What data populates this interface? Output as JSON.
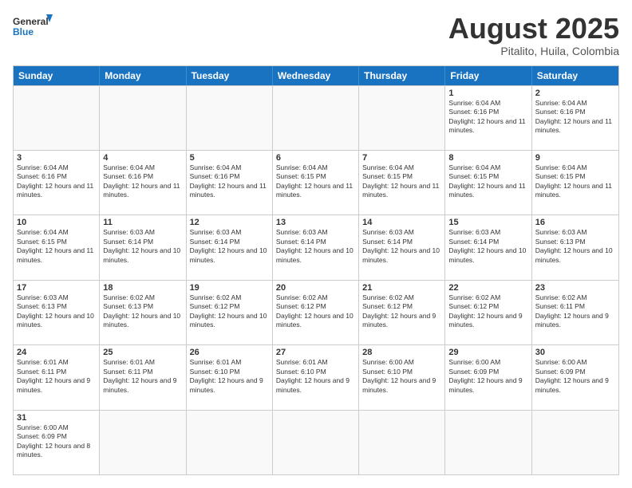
{
  "header": {
    "logo_general": "General",
    "logo_blue": "Blue",
    "month_title": "August 2025",
    "subtitle": "Pitalito, Huila, Colombia"
  },
  "weekdays": [
    "Sunday",
    "Monday",
    "Tuesday",
    "Wednesday",
    "Thursday",
    "Friday",
    "Saturday"
  ],
  "rows": [
    [
      {
        "day": "",
        "info": ""
      },
      {
        "day": "",
        "info": ""
      },
      {
        "day": "",
        "info": ""
      },
      {
        "day": "",
        "info": ""
      },
      {
        "day": "",
        "info": ""
      },
      {
        "day": "1",
        "info": "Sunrise: 6:04 AM\nSunset: 6:16 PM\nDaylight: 12 hours and 11 minutes."
      },
      {
        "day": "2",
        "info": "Sunrise: 6:04 AM\nSunset: 6:16 PM\nDaylight: 12 hours and 11 minutes."
      }
    ],
    [
      {
        "day": "3",
        "info": "Sunrise: 6:04 AM\nSunset: 6:16 PM\nDaylight: 12 hours and 11 minutes."
      },
      {
        "day": "4",
        "info": "Sunrise: 6:04 AM\nSunset: 6:16 PM\nDaylight: 12 hours and 11 minutes."
      },
      {
        "day": "5",
        "info": "Sunrise: 6:04 AM\nSunset: 6:16 PM\nDaylight: 12 hours and 11 minutes."
      },
      {
        "day": "6",
        "info": "Sunrise: 6:04 AM\nSunset: 6:15 PM\nDaylight: 12 hours and 11 minutes."
      },
      {
        "day": "7",
        "info": "Sunrise: 6:04 AM\nSunset: 6:15 PM\nDaylight: 12 hours and 11 minutes."
      },
      {
        "day": "8",
        "info": "Sunrise: 6:04 AM\nSunset: 6:15 PM\nDaylight: 12 hours and 11 minutes."
      },
      {
        "day": "9",
        "info": "Sunrise: 6:04 AM\nSunset: 6:15 PM\nDaylight: 12 hours and 11 minutes."
      }
    ],
    [
      {
        "day": "10",
        "info": "Sunrise: 6:04 AM\nSunset: 6:15 PM\nDaylight: 12 hours and 11 minutes."
      },
      {
        "day": "11",
        "info": "Sunrise: 6:03 AM\nSunset: 6:14 PM\nDaylight: 12 hours and 10 minutes."
      },
      {
        "day": "12",
        "info": "Sunrise: 6:03 AM\nSunset: 6:14 PM\nDaylight: 12 hours and 10 minutes."
      },
      {
        "day": "13",
        "info": "Sunrise: 6:03 AM\nSunset: 6:14 PM\nDaylight: 12 hours and 10 minutes."
      },
      {
        "day": "14",
        "info": "Sunrise: 6:03 AM\nSunset: 6:14 PM\nDaylight: 12 hours and 10 minutes."
      },
      {
        "day": "15",
        "info": "Sunrise: 6:03 AM\nSunset: 6:14 PM\nDaylight: 12 hours and 10 minutes."
      },
      {
        "day": "16",
        "info": "Sunrise: 6:03 AM\nSunset: 6:13 PM\nDaylight: 12 hours and 10 minutes."
      }
    ],
    [
      {
        "day": "17",
        "info": "Sunrise: 6:03 AM\nSunset: 6:13 PM\nDaylight: 12 hours and 10 minutes."
      },
      {
        "day": "18",
        "info": "Sunrise: 6:02 AM\nSunset: 6:13 PM\nDaylight: 12 hours and 10 minutes."
      },
      {
        "day": "19",
        "info": "Sunrise: 6:02 AM\nSunset: 6:12 PM\nDaylight: 12 hours and 10 minutes."
      },
      {
        "day": "20",
        "info": "Sunrise: 6:02 AM\nSunset: 6:12 PM\nDaylight: 12 hours and 10 minutes."
      },
      {
        "day": "21",
        "info": "Sunrise: 6:02 AM\nSunset: 6:12 PM\nDaylight: 12 hours and 9 minutes."
      },
      {
        "day": "22",
        "info": "Sunrise: 6:02 AM\nSunset: 6:12 PM\nDaylight: 12 hours and 9 minutes."
      },
      {
        "day": "23",
        "info": "Sunrise: 6:02 AM\nSunset: 6:11 PM\nDaylight: 12 hours and 9 minutes."
      }
    ],
    [
      {
        "day": "24",
        "info": "Sunrise: 6:01 AM\nSunset: 6:11 PM\nDaylight: 12 hours and 9 minutes."
      },
      {
        "day": "25",
        "info": "Sunrise: 6:01 AM\nSunset: 6:11 PM\nDaylight: 12 hours and 9 minutes."
      },
      {
        "day": "26",
        "info": "Sunrise: 6:01 AM\nSunset: 6:10 PM\nDaylight: 12 hours and 9 minutes."
      },
      {
        "day": "27",
        "info": "Sunrise: 6:01 AM\nSunset: 6:10 PM\nDaylight: 12 hours and 9 minutes."
      },
      {
        "day": "28",
        "info": "Sunrise: 6:00 AM\nSunset: 6:10 PM\nDaylight: 12 hours and 9 minutes."
      },
      {
        "day": "29",
        "info": "Sunrise: 6:00 AM\nSunset: 6:09 PM\nDaylight: 12 hours and 9 minutes."
      },
      {
        "day": "30",
        "info": "Sunrise: 6:00 AM\nSunset: 6:09 PM\nDaylight: 12 hours and 9 minutes."
      }
    ],
    [
      {
        "day": "31",
        "info": "Sunrise: 6:00 AM\nSunset: 6:09 PM\nDaylight: 12 hours and 8 minutes."
      },
      {
        "day": "",
        "info": ""
      },
      {
        "day": "",
        "info": ""
      },
      {
        "day": "",
        "info": ""
      },
      {
        "day": "",
        "info": ""
      },
      {
        "day": "",
        "info": ""
      },
      {
        "day": "",
        "info": ""
      }
    ]
  ]
}
